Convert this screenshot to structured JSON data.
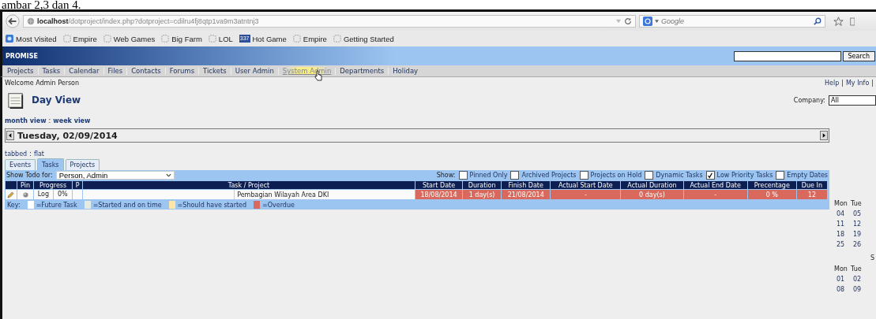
{
  "caption": "ambar 2,3 dan 4.",
  "browser": {
    "url_host": "localhost",
    "url_path": "/dotproject/index.php?dotproject=cdilru4fj8qtp1va9m3atntnj3",
    "search_placeholder": "Google",
    "bookmarks": [
      {
        "label": "Most Visited",
        "kind": "site"
      },
      {
        "label": "Empire",
        "kind": "page"
      },
      {
        "label": "Web Games",
        "kind": "page"
      },
      {
        "label": "Big Farm",
        "kind": "page"
      },
      {
        "label": "LOL",
        "kind": "page"
      },
      {
        "label": "Hot Game",
        "kind": "badge",
        "badge": "337"
      },
      {
        "label": "Empire",
        "kind": "page"
      },
      {
        "label": "Getting Started",
        "kind": "page"
      }
    ]
  },
  "header": {
    "title": "PROMISE",
    "search_button": "Search"
  },
  "nav": [
    {
      "label": "Projects",
      "hovered": false
    },
    {
      "label": "Tasks",
      "hovered": false
    },
    {
      "label": "Calendar",
      "hovered": false
    },
    {
      "label": "Files",
      "hovered": false
    },
    {
      "label": "Contacts",
      "hovered": false
    },
    {
      "label": "Forums",
      "hovered": false
    },
    {
      "label": "Tickets",
      "hovered": false
    },
    {
      "label": "User Admin",
      "hovered": false
    },
    {
      "label": "System Admin",
      "hovered": true
    },
    {
      "label": "Departments",
      "hovered": false
    },
    {
      "label": "Holiday",
      "hovered": false
    }
  ],
  "welcome": "Welcome Admin Person",
  "user_links": [
    "Help",
    "My Info"
  ],
  "link_separator": "|",
  "page_title": "Day View",
  "company": {
    "label": "Company:",
    "value": "All"
  },
  "view_links": [
    "month view",
    "week view"
  ],
  "view_separator": ":",
  "date": "Tuesday, 02/09/2014",
  "mode_links": [
    "tabbed",
    "flat"
  ],
  "tabs": [
    {
      "label": "Events",
      "selected": false
    },
    {
      "label": "Tasks",
      "selected": true
    },
    {
      "label": "Projects",
      "selected": false
    }
  ],
  "todo": {
    "label": "Show Todo for:",
    "value": "Person, Admin"
  },
  "show": {
    "label": "Show:",
    "filters": [
      {
        "label": "Pinned Only",
        "checked": false
      },
      {
        "label": "Archived Projects",
        "checked": false
      },
      {
        "label": "Projects on Hold",
        "checked": false
      },
      {
        "label": "Dynamic Tasks",
        "checked": false
      },
      {
        "label": "Low Priority Tasks",
        "checked": true
      },
      {
        "label": "Empty Dates",
        "checked": false
      }
    ]
  },
  "table": {
    "columns": [
      null,
      "Pin",
      "Progress",
      "P",
      "Task / Project",
      "Start Date",
      "Duration",
      "Finish Date",
      "Actual Start Date",
      "Actual Duration",
      "Actual End Date",
      "Precentage",
      "Due In"
    ],
    "rows": [
      {
        "color": "#d9695d",
        "cells": [
          null,
          null,
          {
            "link": "Log",
            "value": "0%"
          },
          null,
          "Pembagian Wilayah Area DKI",
          "18/08/2014",
          "1 day(s)",
          "21/08/2014",
          "-",
          "0 day(s)",
          "-",
          "0 %",
          "12"
        ]
      }
    ]
  },
  "key": {
    "label": "Key:",
    "items": [
      {
        "color": "#ffffff",
        "label": "=Future Task"
      },
      {
        "color": "#e6ebe0",
        "label": "=Started and on time"
      },
      {
        "color": "#ffe6a8",
        "label": "=Should have started"
      },
      {
        "color": "#d9695d",
        "label": "=Overdue"
      }
    ]
  },
  "mini_calendars": [
    {
      "days": [
        "Mon",
        "Tue"
      ],
      "weeks": [
        [
          "04",
          "05"
        ],
        [
          "11",
          "12"
        ],
        [
          "18",
          "19"
        ],
        [
          "25",
          "26"
        ]
      ]
    },
    {
      "title": "S",
      "days": [
        "Mon",
        "Tue"
      ],
      "weeks": [
        [
          "01",
          "02"
        ],
        [
          "08",
          "09"
        ]
      ]
    }
  ]
}
